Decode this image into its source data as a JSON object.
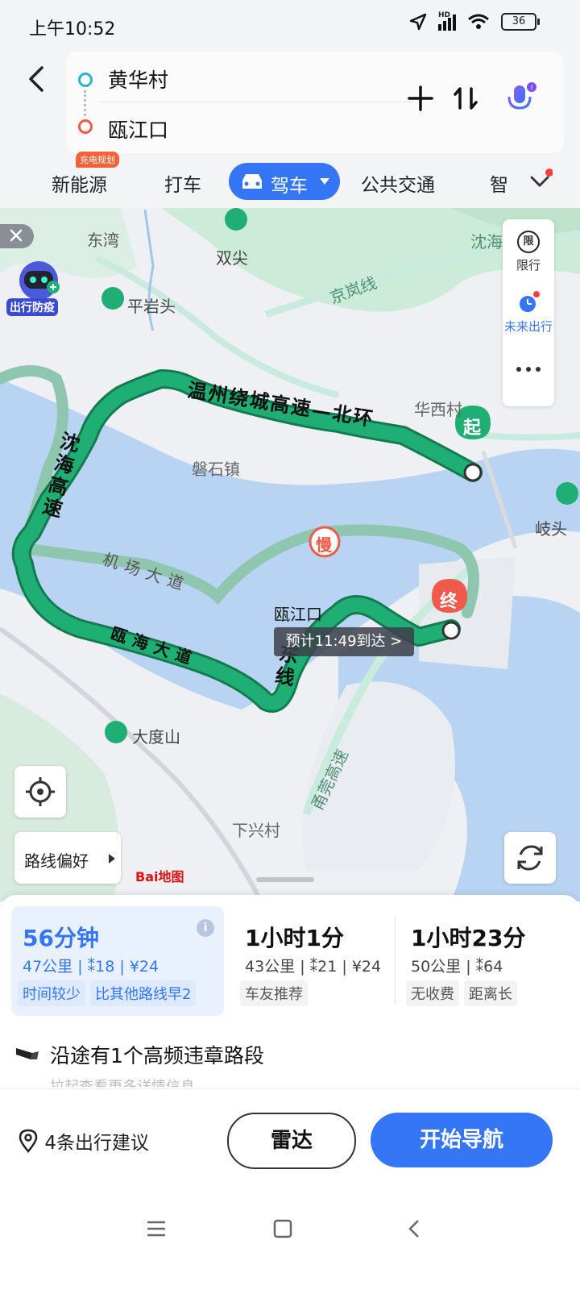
{
  "status_bar": {
    "time": "上午10:52",
    "network": "HD",
    "battery": "36"
  },
  "search": {
    "origin": "黄华村",
    "destination": "瓯江口"
  },
  "tabs": {
    "nev": "新能源",
    "nev_badge": "充电规划",
    "taxi": "打车",
    "drive": "驾车",
    "transit": "公共交通",
    "smart": "智"
  },
  "map": {
    "place_labels": [
      "东湾",
      "双尖",
      "平岩头",
      "京岚线",
      "沈海",
      "华西村",
      "磐石镇",
      "岐头",
      "机场大道",
      "瓯江口",
      "瓯海大道",
      "大度山",
      "下兴村",
      "甬莞高速"
    ],
    "road_labels": {
      "wenzhou_ring": "温州绕城高速—北环",
      "shenhai": "沈海高速",
      "ouhai": "瓯海大道",
      "east_line": "东线"
    },
    "start_marker": "起",
    "end_marker": "终",
    "slow_marker": "慢",
    "eta_tag": "预计11:49到达 >",
    "promo_label": "出行防疫",
    "right_panel": {
      "restrict_icon": "限",
      "restrict": "限行",
      "future": "未来出行"
    },
    "route_preference": "路线偏好",
    "logo": "Bai地图"
  },
  "routes": [
    {
      "time": "56分钟",
      "distance": "47公里",
      "lights": "18",
      "cost": "¥24",
      "tags": [
        "时间较少",
        "比其他路线早2"
      ]
    },
    {
      "time": "1小时1分",
      "distance": "43公里",
      "lights": "21",
      "cost": "¥24",
      "tags": [
        "车友推荐"
      ]
    },
    {
      "time": "1小时23分",
      "distance": "50公里",
      "lights": "64",
      "cost": "",
      "tags": [
        "无收费",
        "距离长"
      ]
    }
  ],
  "warning": {
    "text": "沿途有1个高频违章路段",
    "sub": "拉起查看更多详情信息"
  },
  "actions": {
    "suggest": "4条出行建议",
    "radar": "雷达",
    "navigate": "开始导航"
  },
  "colors": {
    "accent": "#3476f6",
    "route_green": "#1fae73",
    "start_pin": "#1fae73",
    "end_pin": "#f05a4a",
    "water": "#b9d4f3",
    "land_green": "#cdebd9"
  }
}
